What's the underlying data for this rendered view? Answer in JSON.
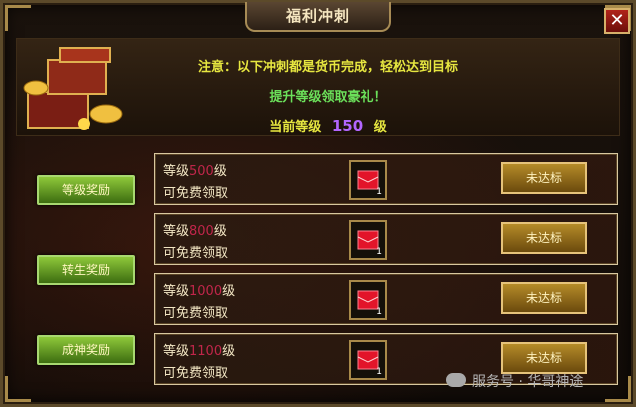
{
  "window": {
    "title": "福利冲刺",
    "close_glyph": "✕"
  },
  "notice": {
    "line1": "注意：以下冲刺都是货币完成，轻松达到目标",
    "line2": "提升等级领取豪礼！",
    "current_level_label": "当前等级",
    "current_level_value": "150",
    "current_level_unit": "级"
  },
  "left_buttons": [
    "等级奖励",
    "转生奖励",
    "成神奖励"
  ],
  "rows": [
    {
      "level_prefix": "等级",
      "level_num": "500",
      "level_suffix": "级",
      "sub": "可免费领取",
      "count": "1",
      "status": "未达标"
    },
    {
      "level_prefix": "等级",
      "level_num": "800",
      "level_suffix": "级",
      "sub": "可免费领取",
      "count": "1",
      "status": "未达标"
    },
    {
      "level_prefix": "等级",
      "level_num": "1000",
      "level_suffix": "级",
      "sub": "可免费领取",
      "count": "1",
      "status": "未达标"
    },
    {
      "level_prefix": "等级",
      "level_num": "1100",
      "level_suffix": "级",
      "sub": "可免费领取",
      "count": "1",
      "status": "未达标"
    }
  ],
  "watermark": "服务号 · 华哥神途",
  "icons": {
    "close": "close-icon",
    "gift": "red-envelope-icon",
    "treasure": "treasure-chest-icon",
    "wechat": "wechat-icon"
  },
  "colors": {
    "accent_gold": "#a88a4a",
    "level_purple": "#b266ff",
    "row_level_red": "#c0264a",
    "notice_yellow": "#e6e640",
    "notice_green": "#6be05a"
  }
}
